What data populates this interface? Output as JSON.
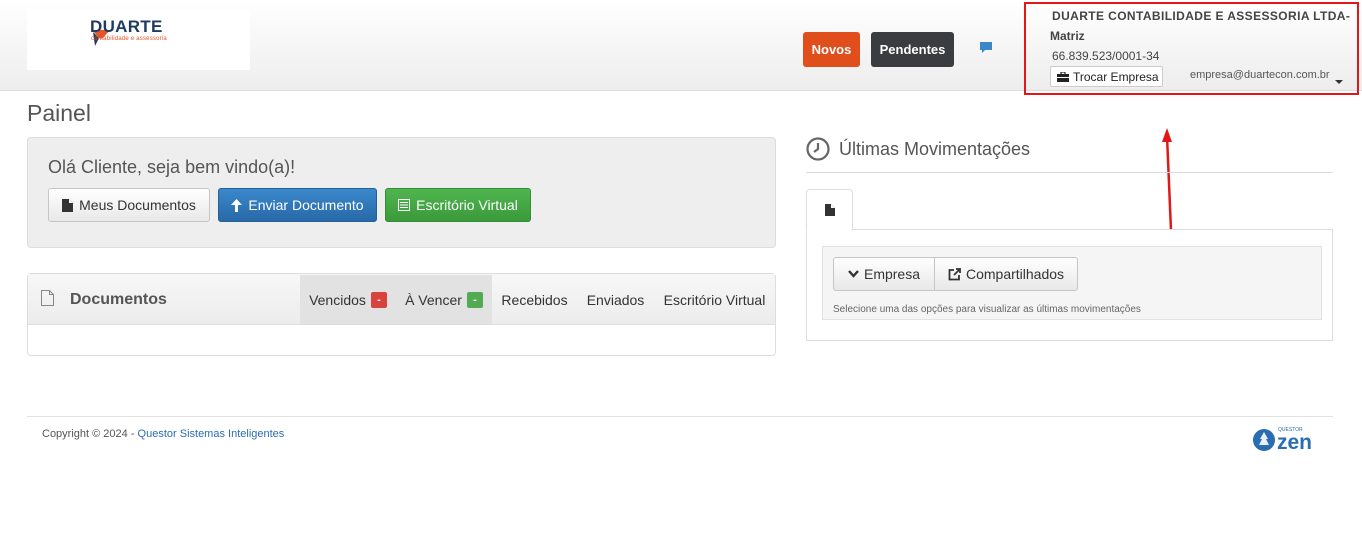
{
  "header": {
    "logo": {
      "name": "DUARTE",
      "tagline": "contabilidade e assessoria"
    },
    "novos_label": "Novos",
    "pendentes_label": "Pendentes",
    "company": {
      "name": "DUARTE CONTABILIDADE E ASSESSORIA LTDA-",
      "branch": "Matriz",
      "cnpj": "66.839.523/0001-34",
      "switch_label": "Trocar Empresa",
      "email": "empresa@duartecon.com.br"
    }
  },
  "page": {
    "title": "Painel"
  },
  "welcome": {
    "greeting": "Olá Cliente, seja bem vindo(a)!",
    "meus_documentos": "Meus Documentos",
    "enviar_documento": "Enviar Documento",
    "escritorio_virtual": "Escritório Virtual"
  },
  "documents": {
    "title": "Documentos",
    "tabs": [
      {
        "label": "Vencidos",
        "badge": "-"
      },
      {
        "label": "À Vencer",
        "badge": "-"
      },
      {
        "label": "Recebidos"
      },
      {
        "label": "Enviados"
      },
      {
        "label": "Escritório Virtual"
      }
    ]
  },
  "movements": {
    "title": "Últimas Movimentações",
    "empresa_label": "Empresa",
    "compartilhados_label": "Compartilhados",
    "hint": "Selecione uma das opções para visualizar as últimas movimentações"
  },
  "footer": {
    "copyright": "Copyright © 2024 - ",
    "link": "Questor Sistemas Inteligentes",
    "brand_small": "QUESTOR",
    "brand": "zen"
  },
  "colors": {
    "novos": "#e04e1c",
    "pendentes": "#3a3c3f",
    "primary": "#2869a8",
    "success": "#3b9a3b",
    "danger": "#d9433e",
    "annotation": "#e01818"
  },
  "icons": [
    "chat-icon",
    "briefcase-icon",
    "file-icon",
    "upload-icon",
    "list-icon",
    "clock-icon",
    "chevron-down-icon",
    "share-icon",
    "caret-down-icon"
  ]
}
